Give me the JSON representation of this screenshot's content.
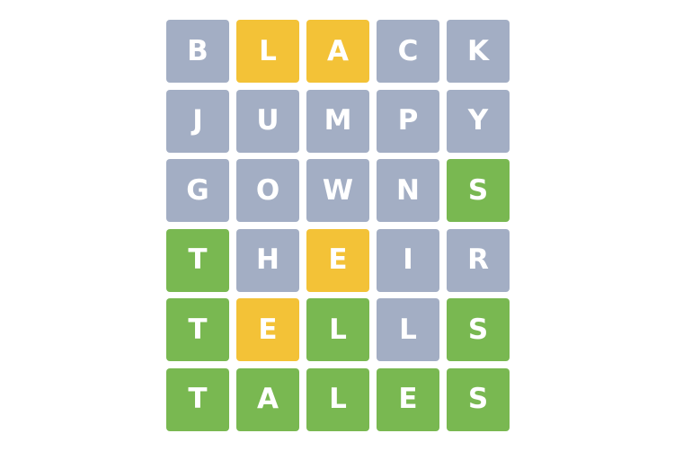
{
  "colors": {
    "absent": "#a3aec4",
    "present": "#f3c237",
    "correct": "#79b851",
    "letter": "#ffffff",
    "background": "#ffffff"
  },
  "board": {
    "rows": [
      {
        "tiles": [
          {
            "letter": "B",
            "state": "absent"
          },
          {
            "letter": "L",
            "state": "present"
          },
          {
            "letter": "A",
            "state": "present"
          },
          {
            "letter": "C",
            "state": "absent"
          },
          {
            "letter": "K",
            "state": "absent"
          }
        ]
      },
      {
        "tiles": [
          {
            "letter": "J",
            "state": "absent"
          },
          {
            "letter": "U",
            "state": "absent"
          },
          {
            "letter": "M",
            "state": "absent"
          },
          {
            "letter": "P",
            "state": "absent"
          },
          {
            "letter": "Y",
            "state": "absent"
          }
        ]
      },
      {
        "tiles": [
          {
            "letter": "G",
            "state": "absent"
          },
          {
            "letter": "O",
            "state": "absent"
          },
          {
            "letter": "W",
            "state": "absent"
          },
          {
            "letter": "N",
            "state": "absent"
          },
          {
            "letter": "S",
            "state": "correct"
          }
        ]
      },
      {
        "tiles": [
          {
            "letter": "T",
            "state": "correct"
          },
          {
            "letter": "H",
            "state": "absent"
          },
          {
            "letter": "E",
            "state": "present"
          },
          {
            "letter": "I",
            "state": "absent"
          },
          {
            "letter": "R",
            "state": "absent"
          }
        ]
      },
      {
        "tiles": [
          {
            "letter": "T",
            "state": "correct"
          },
          {
            "letter": "E",
            "state": "present"
          },
          {
            "letter": "L",
            "state": "correct"
          },
          {
            "letter": "L",
            "state": "absent"
          },
          {
            "letter": "S",
            "state": "correct"
          }
        ]
      },
      {
        "tiles": [
          {
            "letter": "T",
            "state": "correct"
          },
          {
            "letter": "A",
            "state": "correct"
          },
          {
            "letter": "L",
            "state": "correct"
          },
          {
            "letter": "E",
            "state": "correct"
          },
          {
            "letter": "S",
            "state": "correct"
          }
        ]
      }
    ]
  }
}
